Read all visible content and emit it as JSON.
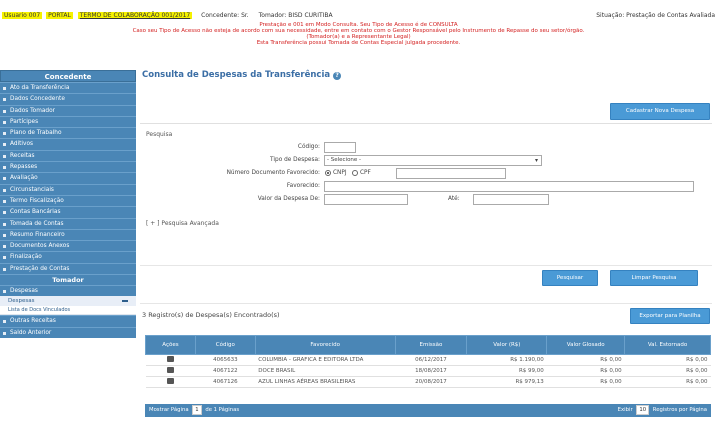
{
  "header": {
    "line_left": "Usuario 007",
    "line_portal": "PORTAL",
    "line_status": "TERMO DE COLABORAÇÃO 001/2017",
    "line_mode": "Concedente: Sr.",
    "line_grantee": "Tomador: BISD CURITIBA",
    "line_right": "Situação: Prestação de Contas Avaliada",
    "warn1": "Prestação e 001 em Modo Consulta. Seu Tipo de Acesso é de CONSULTA",
    "warn2": "Caso seu Tipo de Acesso não esteja de acordo com sua necessidade, entre em contato com o Gestor Responsável pelo Instrumento de Repasse do seu setor/órgão.",
    "warn3": "(Tomador(a) e a Representante Legal)",
    "warn4": "Esta Transferência possui Tomada de Contas Especial julgada procedente."
  },
  "sidebar": {
    "header": "Concedente",
    "items": [
      "Ato da Transferência",
      "Dados Concedente",
      "Dados Tomador",
      "Partícipes",
      "Plano de Trabalho",
      "Aditivos",
      "Receitas",
      "Repasses",
      "Avaliação",
      "Circunstanciais",
      "Termo Fiscalização",
      "Contas Bancárias",
      "Tomada de Contas",
      "Resumo Financeiro",
      "Documentos Anexos",
      "Finalização",
      "Prestação de Contas"
    ],
    "section_tomador": "Tomador",
    "active_item": "Despesas",
    "active_sub": "Despesas",
    "sub_item": "Lista de Docs Vinculados",
    "bottom_items": [
      "Outras Receitas",
      "Saldo Anterior"
    ]
  },
  "main": {
    "title": "Consulta de Despesas da Transferência",
    "top_button": "Cadastrar Nova Despesa",
    "filter_legend": "Pesquisa",
    "fields": {
      "codigo_label": "Código:",
      "tipo_label": "Tipo de Despesa:",
      "tipo_value": "- Selecione -",
      "numero_label": "Número Documento Favorecido:",
      "cnpj": "CNPJ",
      "cpf": "CPF",
      "favorecido_label": "Favorecido:",
      "valor_label": "Valor da Despesa De:",
      "ate_label": "Até:"
    },
    "advanced": "[ + ] Pesquisa Avançada",
    "search_button": "Pesquisar",
    "clear_button": "Limpar Pesquisa",
    "results_text": "3 Registro(s) de Despesa(s) Encontrado(s)",
    "export_button": "Exportar para Planilha",
    "table": {
      "headers": [
        "Ações",
        "Código",
        "Favorecido",
        "Emissão",
        "Valor (R$)",
        "Valor Glosado",
        "Val. Estornado"
      ],
      "rows": [
        {
          "codigo": "4065633",
          "favorecido": "COLUMBIA - GRAFICA E EDITORA LTDA",
          "emissao": "06/12/2017",
          "valor": "R$ 1.190,00",
          "glosado": "R$ 0,00",
          "estornado": "R$ 0,00"
        },
        {
          "codigo": "4067122",
          "favorecido": "DOCE BRASIL",
          "emissao": "18/08/2017",
          "valor": "R$ 99,00",
          "glosado": "R$ 0,00",
          "estornado": "R$ 0,00"
        },
        {
          "codigo": "4067126",
          "favorecido": "AZUL LINHAS AÉREAS BRASILEIRAS",
          "emissao": "20/08/2017",
          "valor": "R$ 979,13",
          "glosado": "R$ 0,00",
          "estornado": "R$ 0,00"
        }
      ]
    },
    "footer_left_a": "Mostrar Página",
    "footer_page": "1",
    "footer_left_b": "de 1 Páginas",
    "footer_right_a": "Exibir",
    "footer_per_page": "10",
    "footer_right_b": "Registros por Página"
  }
}
